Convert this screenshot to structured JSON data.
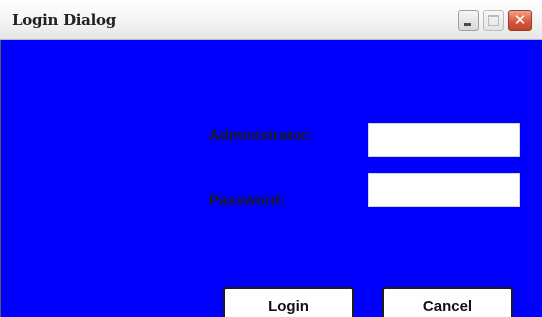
{
  "window": {
    "title": "Login Dialog",
    "minimize_icon": "minimize-icon",
    "maximize_icon": "maximize-icon",
    "close_icon": "close-icon",
    "close_glyph": "✕"
  },
  "form": {
    "background_color": "#0000ff",
    "administrator_label": "Administrator:",
    "administrator_value": "",
    "password_label": "Password:",
    "password_value": ""
  },
  "buttons": {
    "login_label": "Login",
    "cancel_label": "Cancel"
  }
}
